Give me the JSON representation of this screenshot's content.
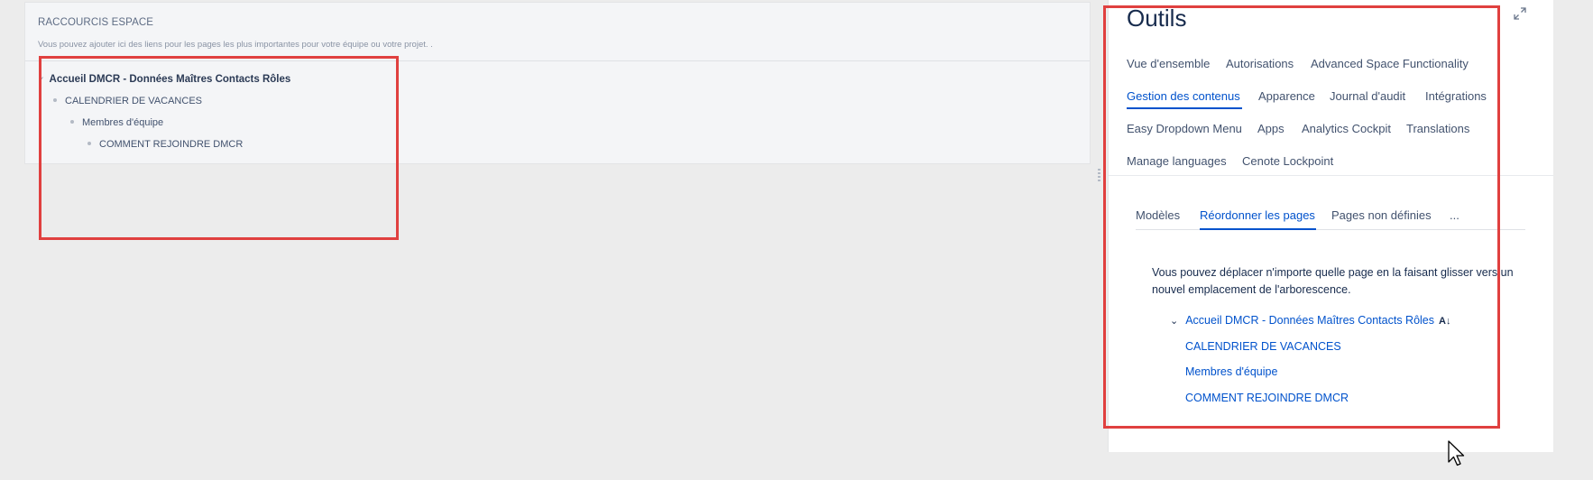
{
  "shortcuts": {
    "title": "RACCOURCIS ESPACE",
    "description": "Vous pouvez ajouter ici des liens pour les pages les plus importantes pour votre équipe ou votre projet. .",
    "tree": {
      "root": "Accueil DMCR - Données Maîtres Contacts Rôles",
      "level1": "CALENDRIER DE VACANCES",
      "level2": "Membres d'équipe",
      "level3": "COMMENT REJOINDRE DMCR"
    }
  },
  "tools": {
    "title": "Outils",
    "nav": [
      "Vue d'ensemble",
      "Autorisations",
      "Advanced Space Functionality",
      "Gestion des contenus",
      "Apparence",
      "Journal d'audit",
      "Intégrations",
      "Easy Dropdown Menu",
      "Apps",
      "Analytics Cockpit",
      "Translations",
      "Manage languages",
      "Cenote Lockpoint"
    ],
    "active_nav": "Gestion des contenus",
    "subtabs": [
      "Modèles",
      "Réordonner les pages",
      "Pages non définies",
      "..."
    ],
    "active_subtab": "Réordonner les pages",
    "info_text": "Vous pouvez déplacer n'importe quelle page en la faisant glisser vers un nouvel emplacement de l'arborescence.",
    "tree": {
      "root": "Accueil DMCR - Données Maîtres Contacts Rôles",
      "children": [
        "CALENDRIER DE VACANCES",
        "Membres d'équipe",
        "COMMENT REJOINDRE DMCR"
      ]
    }
  },
  "colors": {
    "accent": "#0052cc",
    "annotation": "#e0403f",
    "background": "#ececec"
  }
}
